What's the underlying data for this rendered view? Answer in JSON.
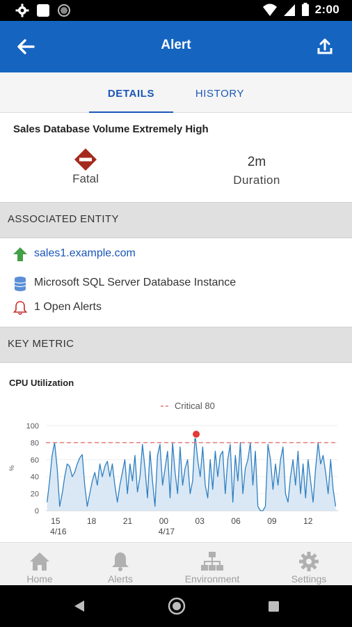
{
  "status_bar": {
    "time": "2:00",
    "left_icons": [
      "gear-icon",
      "square-icon",
      "circle-icon"
    ],
    "right_icons": [
      "wifi-icon",
      "signal-icon",
      "battery-icon"
    ]
  },
  "app_bar": {
    "title": "Alert",
    "back_icon": "arrow-left-icon",
    "share_icon": "share-upload-icon",
    "color": "#1565c0"
  },
  "tabs": [
    {
      "label": "DETAILS",
      "active": true
    },
    {
      "label": "HISTORY",
      "active": false
    }
  ],
  "alert": {
    "title": "Sales Database Volume Extremely High",
    "severity": "Fatal",
    "severity_color": "#a52a1e",
    "duration_value": "2m",
    "duration_label": "Duration"
  },
  "associated_entity": {
    "header": "ASSOCIATED ENTITY",
    "host": "sales1.example.com",
    "type": "Microsoft SQL Server Database Instance",
    "open_alerts": "1 Open Alerts"
  },
  "key_metric": {
    "header": "KEY METRIC"
  },
  "chart_data": {
    "type": "area",
    "title": "CPU Utilization",
    "legend": [
      "Critical 80"
    ],
    "ylabel": "%",
    "ylim": [
      0,
      100
    ],
    "yticks": [
      0,
      20,
      40,
      60,
      80,
      100
    ],
    "xticks": [
      {
        "label": "15",
        "sub": "4/16",
        "hour": 15
      },
      {
        "label": "18",
        "sub": "",
        "hour": 18
      },
      {
        "label": "21",
        "sub": "",
        "hour": 21
      },
      {
        "label": "00",
        "sub": "4/17",
        "hour": 24
      },
      {
        "label": "03",
        "sub": "",
        "hour": 27
      },
      {
        "label": "06",
        "sub": "",
        "hour": 30
      },
      {
        "label": "09",
        "sub": "",
        "hour": 33
      },
      {
        "label": "12",
        "sub": "",
        "hour": 36
      }
    ],
    "xlim_hours": [
      14.2,
      38.5
    ],
    "threshold": 80,
    "threshold_color": "#e57373",
    "line_color": "#2f7fc1",
    "highlight_point": {
      "hour": 26.7,
      "value": 90
    },
    "series": [
      {
        "values": [
          10,
          35,
          65,
          80,
          50,
          5,
          20,
          40,
          55,
          52,
          40,
          45,
          55,
          62,
          66,
          30,
          5,
          20,
          35,
          45,
          30,
          55,
          40,
          52,
          58,
          40,
          55,
          30,
          10,
          30,
          45,
          60,
          20,
          55,
          35,
          65,
          22,
          40,
          78,
          50,
          15,
          70,
          35,
          5,
          65,
          78,
          30,
          50,
          70,
          15,
          80,
          45,
          20,
          75,
          30,
          50,
          60,
          20,
          35,
          90,
          60,
          40,
          75,
          30,
          15,
          60,
          25,
          70,
          40,
          65,
          70,
          20,
          60,
          78,
          10,
          65,
          35,
          80,
          20,
          50,
          60,
          80,
          30,
          70,
          5,
          0,
          0,
          5,
          78,
          60,
          25,
          55,
          30,
          60,
          75,
          20,
          10,
          40,
          60,
          30,
          70,
          20,
          55,
          15,
          60,
          35,
          10,
          50,
          80,
          55,
          65,
          45,
          20,
          60,
          25,
          5
        ]
      }
    ]
  },
  "bottom_nav": [
    {
      "label": "Home",
      "icon": "home-icon"
    },
    {
      "label": "Alerts",
      "icon": "bell-icon"
    },
    {
      "label": "Environment",
      "icon": "hierarchy-icon"
    },
    {
      "label": "Settings",
      "icon": "gear-icon"
    }
  ]
}
